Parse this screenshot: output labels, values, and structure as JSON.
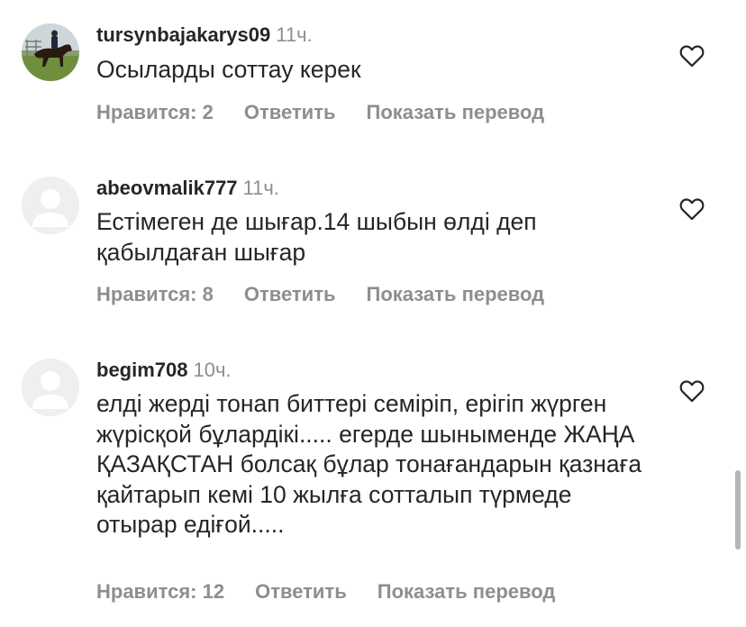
{
  "comments": [
    {
      "username": "tursynbajakarys09",
      "time": "11ч.",
      "text": "Осыларды соттау керек",
      "likes": "Нравится: 2",
      "reply": "Ответить",
      "translate": "Показать перевод",
      "avatar": "photo-horse-rider"
    },
    {
      "username": "abeovmalik777",
      "time": "11ч.",
      "text": "Естімеген де шығар.14 шыбын өлді деп қабылдаған шығар",
      "likes": "Нравится: 8",
      "reply": "Ответить",
      "translate": "Показать перевод",
      "avatar": "default-user-icon"
    },
    {
      "username": "begim708",
      "time": "10ч.",
      "text": "елді жерді тонап биттері семіріп,  ерігіп жүрген жүрісқой бұлардікі..... егерде шыныменде ЖАҢА ҚАЗАҚСТАН болсақ бұлар тонағандарын қазнаға қайтарып кемі 10 жылға сотталып түрмеде отырар едіғой.....",
      "likes": "Нравится: 12",
      "reply": "Ответить",
      "translate": "Показать перевод",
      "avatar": "default-user-icon"
    }
  ],
  "colors": {
    "text": "#262626",
    "secondary": "#8e8e8e",
    "avatar_bg": "#efefef"
  }
}
